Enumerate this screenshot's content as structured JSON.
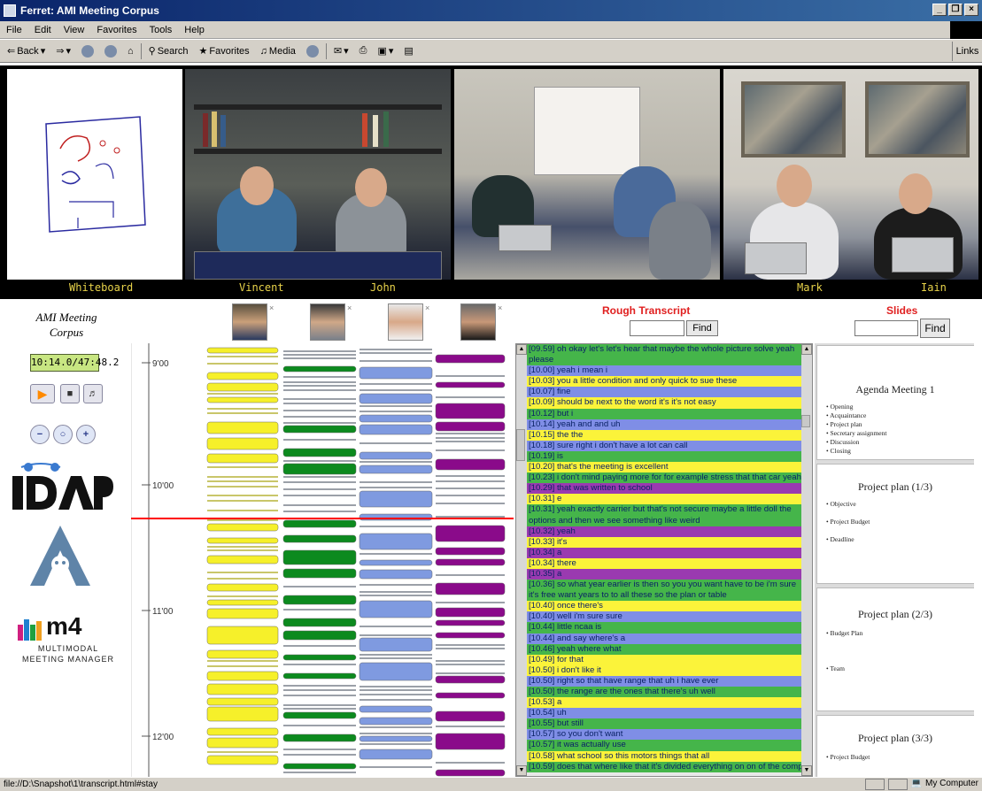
{
  "window": {
    "title": "Ferret: AMI Meeting Corpus",
    "buttons": [
      "_",
      "❒",
      "×"
    ]
  },
  "menu": [
    "File",
    "Edit",
    "View",
    "Favorites",
    "Tools",
    "Help"
  ],
  "toolbar": {
    "back": "Back",
    "search": "Search",
    "favorites": "Favorites",
    "media": "Media",
    "links": "Links"
  },
  "video": {
    "labels": [
      "Whiteboard",
      "Vincent",
      "John",
      "Mark",
      "Iain"
    ]
  },
  "left_panel": {
    "corpus_title_1": "AMI Meeting",
    "corpus_title_2": "Corpus",
    "time": "10:14.0/47:48.2",
    "m4_name": "m4",
    "m4_sub1": "MULTIMODAL",
    "m4_sub2": "MEETING MANAGER"
  },
  "timeline": {
    "ticks": [
      "9'00",
      "10'00",
      "11'00",
      "12'00"
    ],
    "colors": {
      "yellow": "#f6f02a",
      "green": "#0c8a1e",
      "blue": "#7f9ae0",
      "purple": "#8a0a8a",
      "cursor": "#ff0000"
    }
  },
  "transcript": {
    "heading": "Rough Transcript",
    "find_label": "Find",
    "lines": [
      {
        "t": "[09.59] oh okay let's let's hear that maybe the whole picture solve yeah please",
        "c": "green",
        "wrap": true
      },
      {
        "t": "[10.00] yeah i mean i",
        "c": "blue"
      },
      {
        "t": "[10.03] you a little condition and only quick to sue these",
        "c": "yellow"
      },
      {
        "t": "[10.07] fine",
        "c": "blue"
      },
      {
        "t": "[10.09] should be next to the word it's it's not easy",
        "c": "yellow"
      },
      {
        "t": "[10.12] but i",
        "c": "green"
      },
      {
        "t": "[10.14] yeah and and uh",
        "c": "blue"
      },
      {
        "t": "[10.15] the the",
        "c": "yellow"
      },
      {
        "t": "[10.18] sure right i don't have a lot can call",
        "c": "blue"
      },
      {
        "t": "[10.19] is",
        "c": "green"
      },
      {
        "t": "[10.20] that's the meeting is excellent",
        "c": "yellow"
      },
      {
        "t": "[10.23] i don't mind paying more for for example stress that that car yeah",
        "c": "green"
      },
      {
        "t": "[10.29] that was written to school",
        "c": "purple"
      },
      {
        "t": "[10.31] e",
        "c": "yellow"
      },
      {
        "t": "[10.31] yeah exactly carrier but that's not secure maybe a little doll the options and then we see something like weird",
        "c": "green",
        "wrap": true
      },
      {
        "t": "[10.32] yeah",
        "c": "purple"
      },
      {
        "t": "[10.33] it's",
        "c": "yellow"
      },
      {
        "t": "[10.34] a",
        "c": "purple"
      },
      {
        "t": "[10.34] there",
        "c": "yellow"
      },
      {
        "t": "[10.35] a",
        "c": "purple"
      },
      {
        "t": "[10.36] so what year earlier is then so you you want have to be i'm sure it's free want years to to all these so the plan or table",
        "c": "green",
        "wrap": true
      },
      {
        "t": "[10.40] once there's",
        "c": "yellow"
      },
      {
        "t": "[10.40] well i'm sure sure",
        "c": "blue"
      },
      {
        "t": "[10.44] little ncaa is",
        "c": "green"
      },
      {
        "t": "[10.44] and say where's a",
        "c": "blue"
      },
      {
        "t": "[10.46] yeah where what",
        "c": "green"
      },
      {
        "t": "[10.49] for that",
        "c": "yellow"
      },
      {
        "t": "[10.50] i don't like it",
        "c": "yellow"
      },
      {
        "t": "[10.50] right so that have range that uh i have ever",
        "c": "blue"
      },
      {
        "t": "[10.50] the range are the ones that there's uh well",
        "c": "green"
      },
      {
        "t": "[10.53] a",
        "c": "yellow"
      },
      {
        "t": "[10.54] uh",
        "c": "blue"
      },
      {
        "t": "[10.55] but still",
        "c": "green"
      },
      {
        "t": "[10.57] so you don't want",
        "c": "blue"
      },
      {
        "t": "[10.57] it was actually use",
        "c": "green"
      },
      {
        "t": "[10.58] what school so this motors things that all",
        "c": "yellow"
      },
      {
        "t": "[10.59] does that where like that it's divided everything on on of the company",
        "c": "green"
      }
    ],
    "colors": {
      "green": "#45b54a",
      "blue": "#7f8ee6",
      "yellow": "#fbf33a",
      "purple": "#9a3ab0"
    }
  },
  "slides": {
    "heading": "Slides",
    "find_label": "Find",
    "items": [
      {
        "title": "Agenda Meeting 1",
        "bullets": [
          "Opening",
          "Acquaintance",
          "Project plan",
          "Secretary assignment",
          "Discussion",
          "Closing"
        ]
      },
      {
        "title": "Project plan (1/3)",
        "bullets": [
          "Objective",
          "Project Budget",
          "Deadline"
        ]
      },
      {
        "title": "Project plan (2/3)",
        "bullets": [
          "Budget Plan",
          "Team"
        ]
      },
      {
        "title": "Project plan (3/3)",
        "bullets": [
          "Project Budget"
        ]
      }
    ]
  },
  "status": {
    "url": "file://D:\\Snapshot\\1\\transcript.html#stay",
    "zone": "My Computer"
  }
}
